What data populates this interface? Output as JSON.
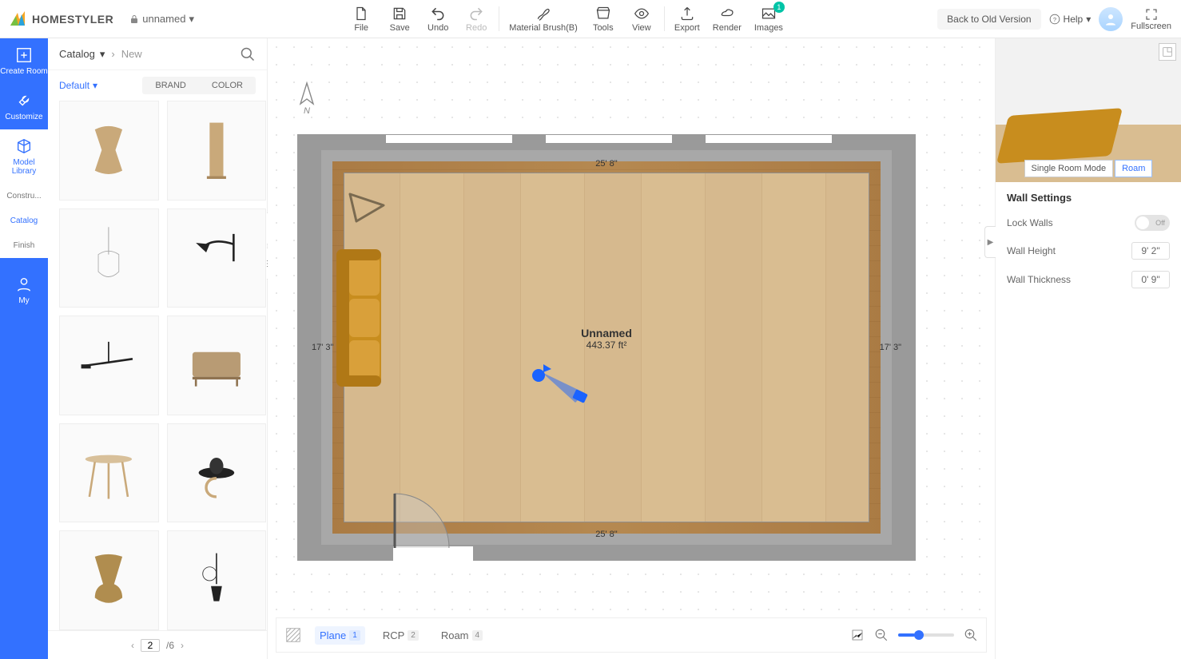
{
  "brand": "HOMESTYLER",
  "project_name": "unnamed",
  "toolbar": {
    "file": "File",
    "save": "Save",
    "undo": "Undo",
    "redo": "Redo",
    "material_brush": "Material Brush(B)",
    "tools": "Tools",
    "view": "View",
    "export": "Export",
    "render": "Render",
    "images": "Images",
    "images_badge": "1"
  },
  "top_right": {
    "back_old": "Back to Old Version",
    "help": "Help",
    "fullscreen": "Fullscreen"
  },
  "left_rail": {
    "create_room": "Create Room",
    "customize": "Customize",
    "model_library": "Model Library",
    "construction": "Constru...",
    "catalog": "Catalog",
    "finish": "Finish",
    "my": "My"
  },
  "catalog": {
    "breadcrumb_root": "Catalog",
    "breadcrumb_leaf": "New",
    "default_label": "Default",
    "brand_tab": "BRAND",
    "color_tab": "COLOR",
    "page_current": "2",
    "page_total": "/6"
  },
  "canvas": {
    "room_name": "Unnamed",
    "room_area": "443.37 ft²",
    "dim_top": "25' 8\"",
    "dim_bottom": "25' 8\"",
    "dim_left": "17' 3\"",
    "dim_right": "17' 3\""
  },
  "bottom_tabs": {
    "plane": "Plane",
    "plane_key": "1",
    "rcp": "RCP",
    "rcp_key": "2",
    "roam": "Roam",
    "roam_key": "4"
  },
  "mode_tabs": {
    "single": "Single Room Mode",
    "roam": "Roam"
  },
  "settings": {
    "title": "Wall Settings",
    "lock_walls": "Lock Walls",
    "lock_value": "Off",
    "wall_height_label": "Wall Height",
    "wall_height": "9' 2\"",
    "wall_thickness_label": "Wall Thickness",
    "wall_thickness": "0' 9\""
  }
}
